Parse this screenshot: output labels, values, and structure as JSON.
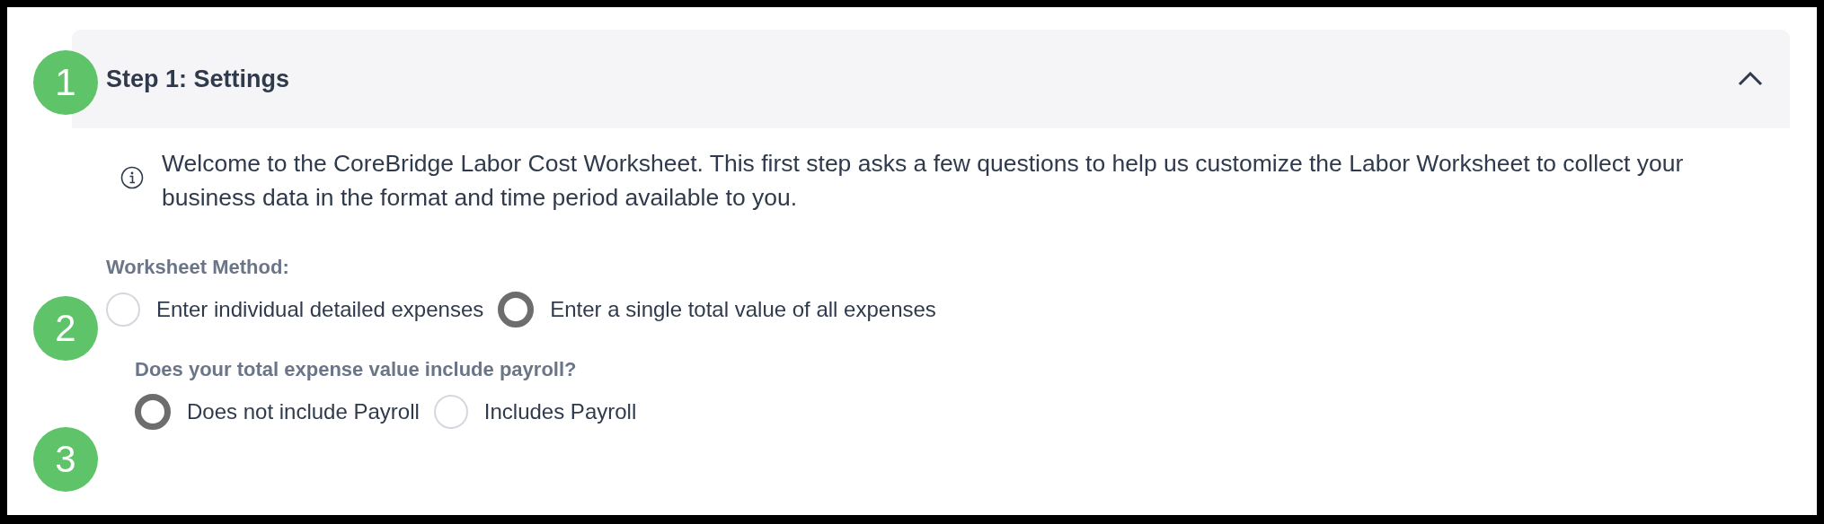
{
  "section": {
    "title": "Step 1: Settings",
    "expanded": true,
    "info": "Welcome to the CoreBridge Labor Cost Worksheet. This first step asks a few questions to help us customize the Labor Worksheet to collect your business data in the format and time period available to you.",
    "groups": [
      {
        "label": "Worksheet Method:",
        "options": [
          {
            "label": "Enter individual detailed expenses",
            "selected": false
          },
          {
            "label": "Enter a single total value of all expenses",
            "selected": true
          }
        ]
      },
      {
        "label": "Does your total expense value include payroll?",
        "options": [
          {
            "label": "Does not include Payroll",
            "selected": true
          },
          {
            "label": "Includes Payroll",
            "selected": false
          }
        ]
      }
    ]
  },
  "step_markers": [
    "1",
    "2",
    "3"
  ]
}
